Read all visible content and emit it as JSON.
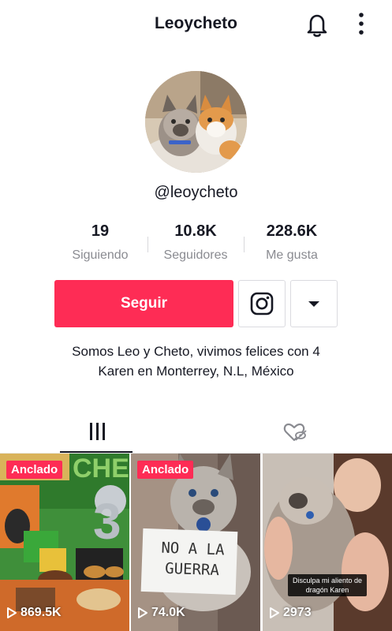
{
  "header": {
    "title": "Leoycheto",
    "bell_icon": "bell-icon",
    "more_icon": "more-vertical-icon"
  },
  "profile": {
    "handle": "@leoycheto",
    "avatar_icon": "profile-avatar"
  },
  "stats": [
    {
      "value": "19",
      "label": "Siguiendo"
    },
    {
      "value": "10.8K",
      "label": "Seguidores"
    },
    {
      "value": "228.6K",
      "label": "Me gusta"
    }
  ],
  "actions": {
    "follow_label": "Seguir",
    "instagram_icon": "instagram-icon",
    "dropdown_icon": "caret-down-icon"
  },
  "bio": {
    "line1": "Somos Leo y Cheto, vivimos felices con 4",
    "line2": "Karen en Monterrey, N.L, México"
  },
  "tabs": [
    {
      "icon": "videos-grid-icon",
      "active": true
    },
    {
      "icon": "liked-hidden-icon",
      "active": false
    }
  ],
  "videos": [
    {
      "badge": "Anclado",
      "views": "869.5K"
    },
    {
      "badge": "Anclado",
      "views": "74.0K",
      "sign_text": "NO A LA GUERRA"
    },
    {
      "views": "2973",
      "caption": "Disculpa mi aliento de dragón Karen"
    }
  ],
  "colors": {
    "accent": "#fe2c55",
    "text": "#161823",
    "muted": "#8a8b91"
  }
}
